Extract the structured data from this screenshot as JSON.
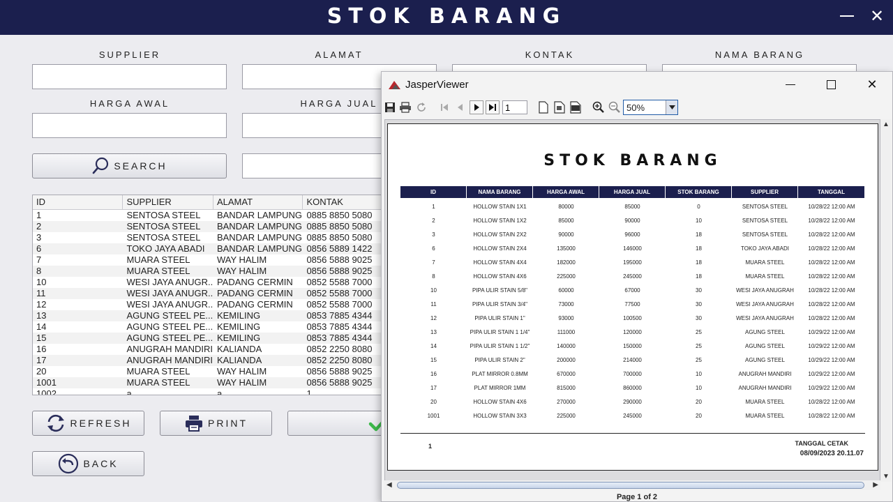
{
  "app": {
    "title": "STOK BARANG",
    "window_minimize": "—",
    "window_close": "✕"
  },
  "form": {
    "supplier_label": "SUPPLIER",
    "alamat_label": "ALAMAT",
    "kontak_label": "KONTAK",
    "nama_barang_label": "NAMA BARANG",
    "harga_awal_label": "HARGA AWAL",
    "harga_jual_label": "HARGA JUAL",
    "supplier_value": "",
    "alamat_value": "",
    "kontak_value": "",
    "nama_barang_value": "",
    "harga_awal_value": "",
    "harga_jual_value": "",
    "search_value": ""
  },
  "buttons": {
    "search": "SEARCH",
    "refresh": "REFRESH",
    "print": "PRINT",
    "back": "BACK"
  },
  "table": {
    "columns": [
      "ID",
      "SUPPLIER",
      "ALAMAT",
      "KONTAK"
    ],
    "rows": [
      [
        "1",
        "SENTOSA STEEL",
        "BANDAR LAMPUNG",
        "0885 8850 5080"
      ],
      [
        "2",
        "SENTOSA STEEL",
        "BANDAR LAMPUNG",
        "0885 8850 5080"
      ],
      [
        "3",
        "SENTOSA STEEL",
        "BANDAR LAMPUNG",
        "0885 8850 5080"
      ],
      [
        "6",
        "TOKO JAYA ABADI",
        "BANDAR LAMPUNG",
        "0856 5889 1422"
      ],
      [
        "7",
        "MUARA STEEL",
        "WAY HALIM",
        "0856 5888 9025"
      ],
      [
        "8",
        "MUARA STEEL",
        "WAY HALIM",
        "0856 5888 9025"
      ],
      [
        "10",
        "WESI JAYA ANUGR...",
        "PADANG CERMIN",
        "0852 5588 7000"
      ],
      [
        "11",
        "WESI JAYA ANUGR...",
        "PADANG CERMIN",
        "0852 5588 7000"
      ],
      [
        "12",
        "WESI JAYA ANUGR...",
        "PADANG CERMIN",
        "0852 5588 7000"
      ],
      [
        "13",
        "AGUNG STEEL PE...",
        "KEMILING",
        "0853 7885 4344"
      ],
      [
        "14",
        "AGUNG STEEL PE...",
        "KEMILING",
        "0853 7885 4344"
      ],
      [
        "15",
        "AGUNG STEEL PE...",
        "KEMILING",
        "0853 7885 4344"
      ],
      [
        "16",
        "ANUGRAH MANDIRI",
        "KALIANDA",
        "0852 2250 8080"
      ],
      [
        "17",
        "ANUGRAH MANDIRI",
        "KALIANDA",
        "0852 2250 8080"
      ],
      [
        "20",
        "MUARA STEEL",
        "WAY HALIM",
        "0856 5888 9025"
      ],
      [
        "1001",
        "MUARA STEEL",
        "WAY HALIM",
        "0856 5888 9025"
      ],
      [
        "1002",
        "a",
        "a",
        "1"
      ]
    ]
  },
  "viewer": {
    "title": "JasperViewer",
    "page_input": "1",
    "zoom": "50%",
    "status": "Page 1 of 2",
    "report": {
      "title": "STOK BARANG",
      "columns": [
        "ID",
        "NAMA BARANG",
        "HARGA AWAL",
        "HARGA JUAL",
        "STOK BARANG",
        "SUPPLIER",
        "TANGGAL"
      ],
      "rows": [
        [
          "1",
          "HOLLOW STAIN 1X1",
          "80000",
          "85000",
          "0",
          "SENTOSA STEEL",
          "10/28/22 12:00 AM"
        ],
        [
          "2",
          "HOLLOW STAIN 1X2",
          "85000",
          "90000",
          "10",
          "SENTOSA STEEL",
          "10/28/22 12:00 AM"
        ],
        [
          "3",
          "HOLLOW STAIN 2X2",
          "90000",
          "96000",
          "18",
          "SENTOSA STEEL",
          "10/28/22 12:00 AM"
        ],
        [
          "6",
          "HOLLOW STAIN 2X4",
          "135000",
          "146000",
          "18",
          "TOKO JAYA ABADI",
          "10/28/22 12:00 AM"
        ],
        [
          "7",
          "HOLLOW STAIN 4X4",
          "182000",
          "195000",
          "18",
          "MUARA STEEL",
          "10/28/22 12:00 AM"
        ],
        [
          "8",
          "HOLLOW STAIN 4X6",
          "225000",
          "245000",
          "18",
          "MUARA STEEL",
          "10/28/22 12:00 AM"
        ],
        [
          "10",
          "PIPA ULIR STAIN 5/8\"",
          "60000",
          "67000",
          "30",
          "WESI JAYA ANUGRAH",
          "10/28/22 12:00 AM"
        ],
        [
          "11",
          "PIPA ULIR STAIN 3/4\"",
          "73000",
          "77500",
          "30",
          "WESI JAYA ANUGRAH",
          "10/28/22 12:00 AM"
        ],
        [
          "12",
          "PIPA ULIR STAIN 1\"",
          "93000",
          "100500",
          "30",
          "WESI JAYA ANUGRAH",
          "10/28/22 12:00 AM"
        ],
        [
          "13",
          "PIPA ULIR STAIN 1 1/4\"",
          "111000",
          "120000",
          "25",
          "AGUNG STEEL",
          "10/29/22 12:00 AM"
        ],
        [
          "14",
          "PIPA ULIR STAIN 1 1/2\"",
          "140000",
          "150000",
          "25",
          "AGUNG STEEL",
          "10/29/22 12:00 AM"
        ],
        [
          "15",
          "PIPA ULIR STAIN 2\"",
          "200000",
          "214000",
          "25",
          "AGUNG STEEL",
          "10/29/22 12:00 AM"
        ],
        [
          "16",
          "PLAT MIRROR 0.8MM",
          "670000",
          "700000",
          "10",
          "ANUGRAH MANDIRI",
          "10/29/22 12:00 AM"
        ],
        [
          "17",
          "PLAT MIRROR 1MM",
          "815000",
          "860000",
          "10",
          "ANUGRAH MANDIRI",
          "10/29/22 12:00 AM"
        ],
        [
          "20",
          "HOLLOW STAIN 4X6",
          "270000",
          "290000",
          "20",
          "MUARA STEEL",
          "10/28/22 12:00 AM"
        ],
        [
          "1001",
          "HOLLOW STAIN 3X3",
          "225000",
          "245000",
          "20",
          "MUARA STEEL",
          "10/28/22 12:00 AM"
        ]
      ],
      "page_number": "1",
      "print_label": "TANGGAL CETAK",
      "print_date": "08/09/2023 20.11.07"
    }
  },
  "colors": {
    "header_navy": "#1b1f4e",
    "check_green": "#3cb94a"
  },
  "icons": {
    "search": "search-icon",
    "refresh": "refresh-icon",
    "print": "printer-icon",
    "back": "back-arrow-icon",
    "confirm": "checkmark-icon"
  }
}
